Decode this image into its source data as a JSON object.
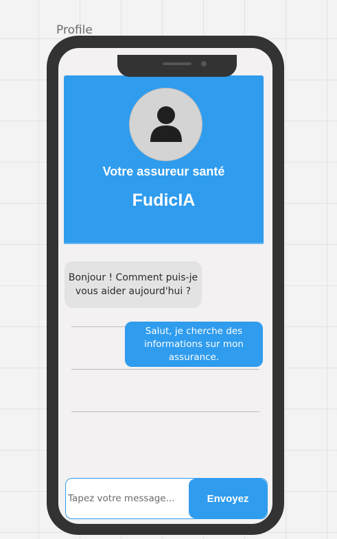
{
  "canvas": {
    "frame_label": "Profile"
  },
  "header": {
    "title": "Votre assureur santé",
    "name": "FudicIA",
    "avatar_icon": "user-icon"
  },
  "chat": {
    "messages": [
      {
        "sender": "bot",
        "text": "Bonjour ! Comment puis-je vous aider aujourd'hui ?"
      },
      {
        "sender": "user",
        "text": "Salut, je cherche des informations sur mon assurance."
      }
    ]
  },
  "composer": {
    "placeholder": "Tapez votre message...",
    "value": "",
    "send_label": "Envoyez"
  },
  "colors": {
    "accent": "#2f9cee",
    "phone_body": "#333333",
    "screen_bg": "#f3f1f1",
    "bot_bubble": "#e3e3e3"
  }
}
